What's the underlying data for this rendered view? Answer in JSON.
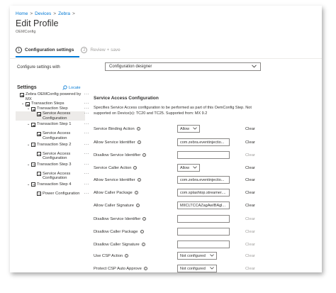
{
  "breadcrumb": [
    "Home",
    "Devices",
    "Zebra"
  ],
  "page": {
    "title": "Edit Profile",
    "subtitle": "OEMConfig"
  },
  "steps": [
    {
      "num": "1",
      "label": "Configuration settings",
      "active": true
    },
    {
      "num": "2",
      "label": "Review + save",
      "active": false
    }
  ],
  "configure": {
    "label": "Configure settings with",
    "value": "Configuration designer"
  },
  "settings": {
    "title": "Settings",
    "locate": "Locate"
  },
  "tree": [
    {
      "label": "Zebra OEMConfig powered by MX",
      "indent": 0,
      "chev": "",
      "dots": true,
      "selected": false
    },
    {
      "label": "Transaction Steps",
      "indent": 1,
      "chev": "⌄",
      "dots": true,
      "selected": false
    },
    {
      "label": "Transaction Step",
      "indent": 2,
      "chev": "⌄",
      "dots": true,
      "selected": false
    },
    {
      "label": "Service Access Configuration",
      "indent": 3,
      "chev": "",
      "dots": true,
      "selected": true
    },
    {
      "label": "Transaction Step 1",
      "indent": 2,
      "chev": "⌄",
      "dots": true,
      "selected": false
    },
    {
      "label": "Service Access Configuration",
      "indent": 3,
      "chev": "",
      "dots": true,
      "selected": false
    },
    {
      "label": "Transaction Step 2",
      "indent": 2,
      "chev": "⌄",
      "dots": true,
      "selected": false
    },
    {
      "label": "Service Access Configuration",
      "indent": 3,
      "chev": "",
      "dots": true,
      "selected": false
    },
    {
      "label": "Transaction Step 3",
      "indent": 2,
      "chev": "⌄",
      "dots": true,
      "selected": false
    },
    {
      "label": "Service Access Configuration",
      "indent": 3,
      "chev": "",
      "dots": true,
      "selected": false
    },
    {
      "label": "Transaction Step 4",
      "indent": 2,
      "chev": "⌄",
      "dots": true,
      "selected": false
    },
    {
      "label": "Power Configuration",
      "indent": 3,
      "chev": "",
      "dots": true,
      "selected": false
    }
  ],
  "form": {
    "section_title": "Service Access Configuration",
    "description": "Specifies Service Access configuration to be performed as part of this OemConfig Step. Not supported on Device(s): TC20 and TC25. Supported from: MX 9.2",
    "rows": [
      {
        "label": "Service Binding Action",
        "type": "dropdown",
        "value": "Allow",
        "clear": "Clear",
        "clear_enabled": true
      },
      {
        "label": "Allow Service Identifier",
        "type": "text",
        "value": "com.zebra.eventinjectio...",
        "clear": "Clear",
        "clear_enabled": true
      },
      {
        "label": "Disallow Service Identifier",
        "type": "text",
        "value": "",
        "clear": "Clear",
        "clear_enabled": false
      },
      {
        "label": "Service Caller Action",
        "type": "dropdown",
        "value": "Allow",
        "clear": "Clear",
        "clear_enabled": true
      },
      {
        "label": "Allow Service Identifier",
        "type": "text",
        "value": "com.zebra.eventinjectio...",
        "clear": "Clear",
        "clear_enabled": true
      },
      {
        "label": "Allow Caller Package",
        "type": "text",
        "value": "com.splashtop.streamer....",
        "clear": "Clear",
        "clear_enabled": true
      },
      {
        "label": "Allow Caller Signature",
        "type": "text",
        "value": "MIICLTCCAZagAwIBAgl...",
        "clear": "Clear",
        "clear_enabled": true
      },
      {
        "label": "Disallow Service Identifier",
        "type": "text",
        "value": "",
        "clear": "Clear",
        "clear_enabled": false
      },
      {
        "label": "Disallow Caller Package",
        "type": "text",
        "value": "",
        "clear": "Clear",
        "clear_enabled": false
      },
      {
        "label": "Disallow Caller Signature",
        "type": "text",
        "value": "",
        "clear": "Clear",
        "clear_enabled": false
      },
      {
        "label": "Use CSP Action",
        "type": "dropdown",
        "value": "Not configured",
        "clear": "Clear",
        "clear_enabled": false
      },
      {
        "label": "Protect CSP Auto Approve",
        "type": "dropdown",
        "value": "Not configured",
        "clear": "Clear",
        "clear_enabled": false
      }
    ]
  },
  "icons": {
    "chevron": "chevron-down-icon",
    "info": "info-icon",
    "tree_item": "list-icon",
    "locate": "locate-icon"
  },
  "colors": {
    "accent": "#0078d4",
    "text": "#323130",
    "muted": "#a19f9d",
    "selected_bg": "#edebe9"
  }
}
